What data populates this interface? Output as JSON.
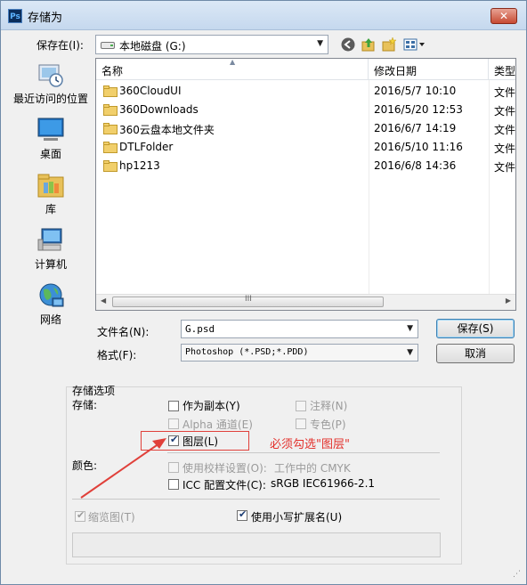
{
  "window": {
    "title": "存储为",
    "app_icon_text": "Ps",
    "close_label": "✕"
  },
  "location": {
    "label": "保存在(I):",
    "value": "本地磁盘 (G:)"
  },
  "toolbar": {
    "back_icon": "back-arrow-icon",
    "up_icon": "up-folder-icon",
    "new_folder_icon": "new-folder-icon",
    "view_icon": "view-menu-icon"
  },
  "sidebar": {
    "items": [
      {
        "label": "最近访问的位置",
        "icon": "recent-places-icon"
      },
      {
        "label": "桌面",
        "icon": "desktop-icon"
      },
      {
        "label": "库",
        "icon": "library-icon"
      },
      {
        "label": "计算机",
        "icon": "computer-icon"
      },
      {
        "label": "网络",
        "icon": "network-icon"
      }
    ]
  },
  "filelist": {
    "columns": {
      "name": "名称",
      "date": "修改日期",
      "type": "类型"
    },
    "rows": [
      {
        "name": "360CloudUI",
        "date": "2016/5/7 10:10",
        "type": "文件"
      },
      {
        "name": "360Downloads",
        "date": "2016/5/20 12:53",
        "type": "文件"
      },
      {
        "name": "360云盘本地文件夹",
        "date": "2016/6/7 14:19",
        "type": "文件"
      },
      {
        "name": "DTLFolder",
        "date": "2016/5/10 11:16",
        "type": "文件"
      },
      {
        "name": "hp1213",
        "date": "2016/6/8 14:36",
        "type": "文件"
      }
    ],
    "scroll_grip": "III"
  },
  "filename": {
    "label": "文件名(N):",
    "value": "G.psd"
  },
  "format": {
    "label": "格式(F):",
    "value": "Photoshop (*.PSD;*.PDD)"
  },
  "buttons": {
    "save": "保存(S)",
    "cancel": "取消"
  },
  "options": {
    "group_title": "存储选项",
    "save_label": "存储:",
    "as_copy": {
      "label": "作为副本(Y)",
      "checked": false,
      "enabled": true
    },
    "notes": {
      "label": "注释(N)",
      "checked": false,
      "enabled": false
    },
    "alpha": {
      "label": "Alpha 通道(E)",
      "checked": false,
      "enabled": false
    },
    "spot": {
      "label": "专色(P)",
      "checked": false,
      "enabled": false
    },
    "layers": {
      "label": "图层(L)",
      "checked": true,
      "enabled": true
    },
    "color_label": "颜色:",
    "proof": {
      "label": "使用校样设置(O):",
      "checked": false,
      "enabled": false,
      "value": "工作中的 CMYK"
    },
    "icc": {
      "label": "ICC 配置文件(C):",
      "checked": false,
      "enabled": true,
      "value": "sRGB IEC61966-2.1"
    },
    "thumbnail": {
      "label": "缩览图(T)",
      "checked": true,
      "enabled": false
    },
    "lowercase_ext": {
      "label": "使用小写扩展名(U)",
      "checked": true,
      "enabled": true
    }
  },
  "annotation": {
    "text": "必须勾选\"图层\"",
    "color": "#e3312c"
  },
  "check_mark": "✔"
}
